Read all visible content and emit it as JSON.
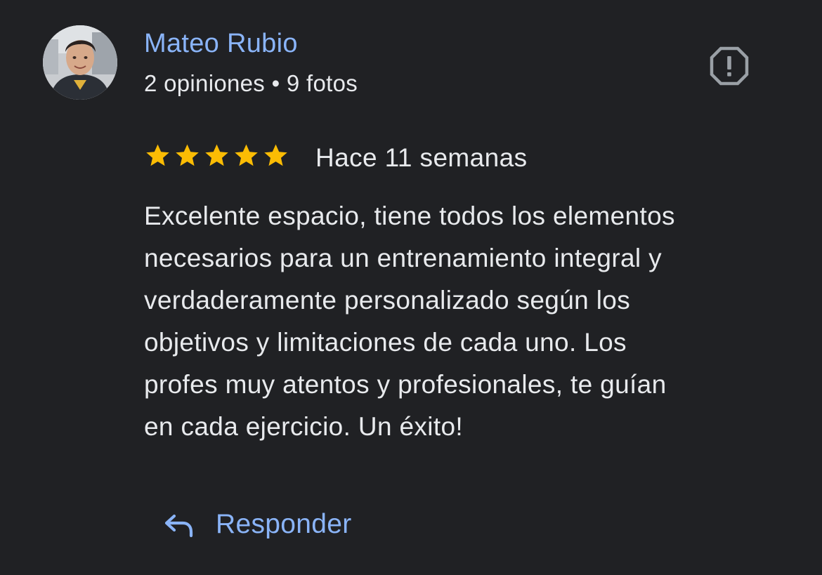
{
  "review": {
    "author": {
      "name": "Mateo Rubio",
      "stats": "2 opiniones • 9 fotos",
      "avatar_icon": "user-photo-avatar"
    },
    "rating": {
      "stars": 5,
      "max_stars": 5,
      "star_color": "#fbbc04"
    },
    "time_ago": "Hace 11 semanas",
    "text_lines": [
      "Excelente espacio, tiene todos los elementos",
      "necesarios para un entrenamiento integral y",
      "verdaderamente personalizado según los",
      "objetivos y limitaciones de cada uno. Los",
      "profes muy atentos y profesionales, te guían",
      "en cada ejercicio. Un éxito!"
    ],
    "report_icon": "report-flag-icon"
  },
  "actions": {
    "reply_label": "Responder",
    "reply_icon": "reply-arrow-icon"
  },
  "colors": {
    "background": "#202124",
    "accent_link": "#8ab4f8",
    "text": "#e8eaed",
    "icon_gray": "#9aa0a6"
  }
}
